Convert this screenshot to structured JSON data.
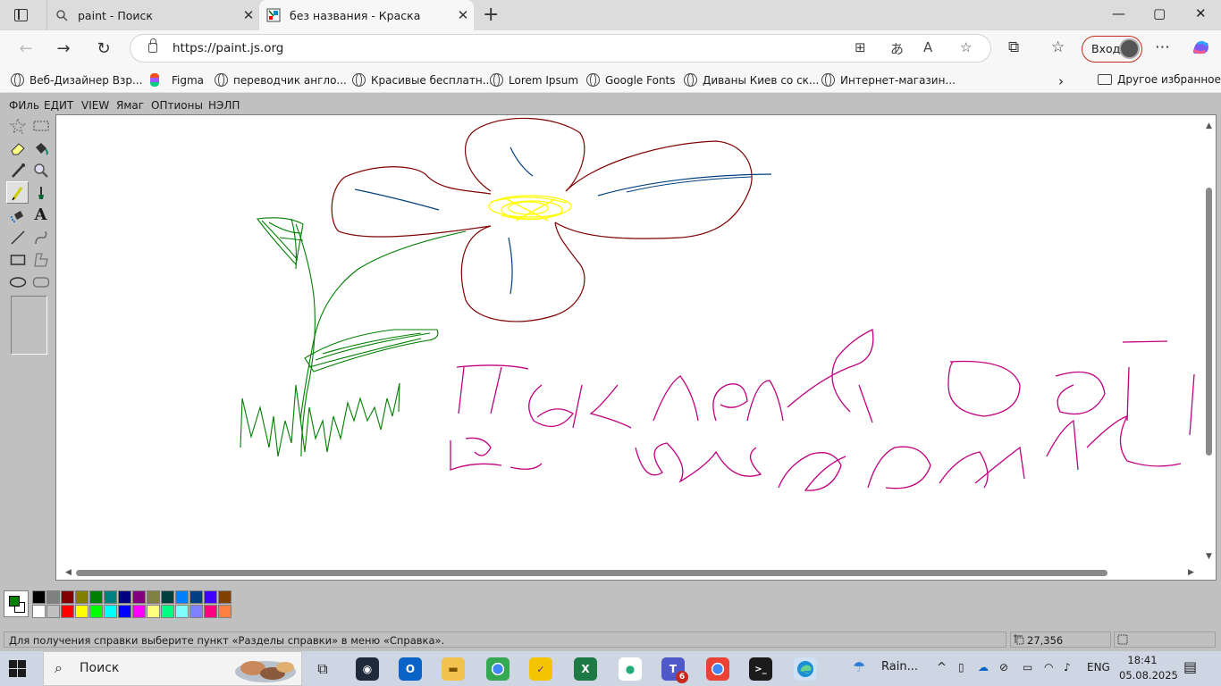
{
  "browser": {
    "tabs": [
      {
        "title": "paint - Поиск",
        "icon": "search-icon"
      },
      {
        "title": "без названия - Краска",
        "icon": "paint-icon"
      }
    ],
    "url": "https://paint.js.org",
    "login_label": "Вход",
    "bookmarks": [
      "Веб-Дизайнер Взр...",
      "Figma",
      "переводчик англо...",
      "Красивые бесплатн...",
      "Lorem Ipsum",
      "Google Fonts",
      "Диваны Киев со ск...",
      "Интернет-магазин..."
    ],
    "other_bookmarks": "Другое избранное"
  },
  "paint": {
    "menu": [
      "ФИль",
      "ЕДИТ",
      "VIEW",
      "Ямаг",
      "ОПтионы",
      "НЭЛП"
    ],
    "tools": [
      "free-select",
      "rect-select",
      "eraser",
      "fill",
      "color-picker",
      "magnifier",
      "pencil",
      "brush",
      "airbrush",
      "text",
      "line",
      "curve",
      "rectangle",
      "polygon",
      "ellipse",
      "rounded-rectangle"
    ],
    "active_tool": "pencil",
    "primary_color": "#007f00",
    "secondary_color": "#ffffff",
    "palette_top": [
      "#000000",
      "#808080",
      "#800000",
      "#808000",
      "#008000",
      "#008080",
      "#000080",
      "#800080",
      "#808040",
      "#004040",
      "#0080ff",
      "#004080",
      "#4000ff",
      "#804000"
    ],
    "palette_bottom": [
      "#ffffff",
      "#c0c0c0",
      "#ff0000",
      "#ffff00",
      "#00ff00",
      "#00ffff",
      "#0000ff",
      "#ff00ff",
      "#ffff80",
      "#00ff80",
      "#80ffff",
      "#8080ff",
      "#ff0080",
      "#ff8040"
    ],
    "status_help": "Для получения справки выберите пункт «Разделы справки» в меню «Справка».",
    "status_coords": "27,356",
    "drawing": {
      "flower_outline": "#800000",
      "flower_center": "#ffff00",
      "vein_color": "#00407f",
      "stem_color": "#007f00",
      "text_color": "#c0007f"
    }
  },
  "taskbar": {
    "search_label": "Поиск",
    "weather": "Rain...",
    "language": "ENG",
    "time": "18:41",
    "date": "05.08.2025",
    "teams_badge": "6"
  }
}
